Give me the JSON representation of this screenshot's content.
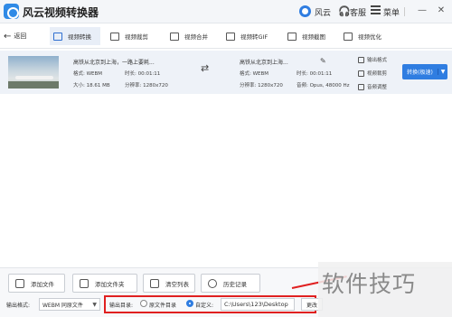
{
  "titlebar": {
    "app_title": "风云视频转换器",
    "user_label": "风云",
    "service_label": "客服",
    "menu_label": "菜单",
    "minimize": "—",
    "close": "✕"
  },
  "toolbar": {
    "back_label": "返回",
    "tabs": [
      {
        "label": "视频转换",
        "active": true
      },
      {
        "label": "视频裁剪"
      },
      {
        "label": "视频合并"
      },
      {
        "label": "视频转GIF"
      },
      {
        "label": "视频截图"
      },
      {
        "label": "视频优化"
      }
    ]
  },
  "file": {
    "source": {
      "name": "高铁从北京到上海，一路上要耗...",
      "format_label": "格式: WEBM",
      "duration_label": "时长: 00:01:11",
      "size_label": "大小: 18.61 MB",
      "resolution_label": "分辨率: 1280x720"
    },
    "output": {
      "name": "高铁从北京到上海...",
      "format_label": "格式: WEBM",
      "duration_label": "时长: 00:01:11",
      "resolution_label": "分辨率: 1280x720",
      "audio_label": "音频: Opus, 48000 Hz"
    },
    "side_links": [
      "输出格式",
      "视频裁剪",
      "音频调整"
    ],
    "convert_button": "转换(极速)"
  },
  "bottom": {
    "buttons": [
      "添加文件",
      "添加文件夹",
      "清空列表",
      "历史记录"
    ],
    "output_format_label": "输出格式:",
    "output_format_value": "WEBM 同原文件",
    "output_dir_label": "输出目录:",
    "radio_source": "原文件目录",
    "radio_custom": "自定义:",
    "path_value": "C:\\Users\\123\\Desktop",
    "open_button": "更改"
  },
  "watermark": "软件技巧",
  "colors": {
    "accent": "#2f7de1",
    "highlight": "#e02020"
  }
}
